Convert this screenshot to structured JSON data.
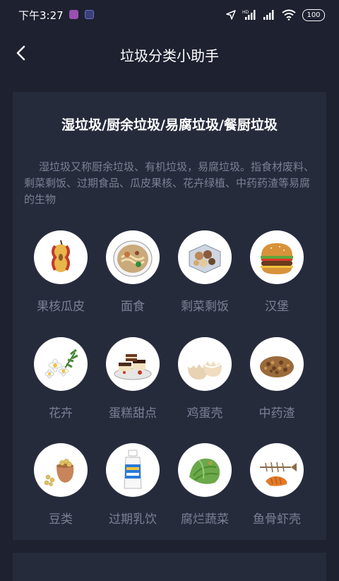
{
  "status_bar": {
    "time": "下午3:27",
    "battery": "100"
  },
  "header": {
    "title": "垃圾分类小助手"
  },
  "category": {
    "title": "湿垃圾/厨余垃圾/易腐垃圾/餐厨垃圾",
    "description": "湿垃圾又称厨余垃圾、有机垃圾，易腐垃圾。指食材废料、剩菜剩饭、过期食品、瓜皮果核、花卉绿植、中药药渣等易腐的生物",
    "items": [
      {
        "label": "果核瓜皮",
        "icon": "apple-core-icon"
      },
      {
        "label": "面食",
        "icon": "noodles-icon"
      },
      {
        "label": "剩菜剩饭",
        "icon": "leftovers-icon"
      },
      {
        "label": "汉堡",
        "icon": "hamburger-icon"
      },
      {
        "label": "花卉",
        "icon": "flower-icon"
      },
      {
        "label": "蛋糕甜点",
        "icon": "cake-icon"
      },
      {
        "label": "鸡蛋壳",
        "icon": "eggshell-icon"
      },
      {
        "label": "中药渣",
        "icon": "herb-residue-icon"
      },
      {
        "label": "豆类",
        "icon": "beans-icon"
      },
      {
        "label": "过期乳饮",
        "icon": "yogurt-bottle-icon"
      },
      {
        "label": "腐烂蔬菜",
        "icon": "rotten-vegetable-icon"
      },
      {
        "label": "鱼骨虾壳",
        "icon": "fishbone-shrimp-icon"
      }
    ]
  },
  "colors": {
    "background": "#1d2130",
    "card": "#262b3c",
    "muted_text": "#7a8194"
  }
}
